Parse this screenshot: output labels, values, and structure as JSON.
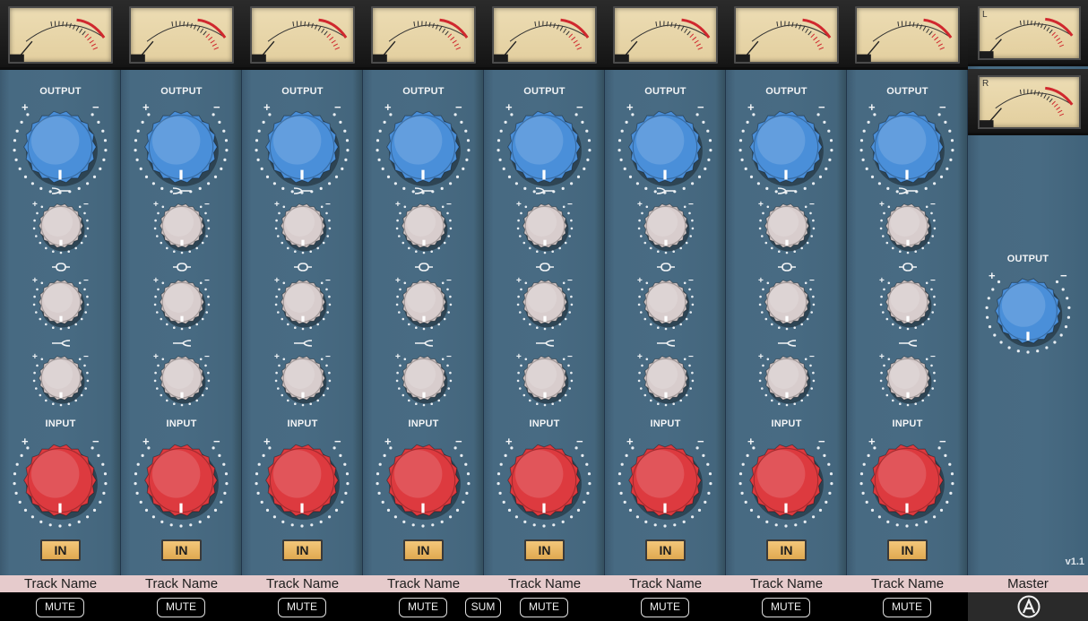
{
  "channels": [
    {
      "output_label": "OUTPUT",
      "input_label": "INPUT",
      "in_label": "IN",
      "track_name": "Track Name",
      "mute_label": "MUTE"
    },
    {
      "output_label": "OUTPUT",
      "input_label": "INPUT",
      "in_label": "IN",
      "track_name": "Track Name",
      "mute_label": "MUTE"
    },
    {
      "output_label": "OUTPUT",
      "input_label": "INPUT",
      "in_label": "IN",
      "track_name": "Track Name",
      "mute_label": "MUTE"
    },
    {
      "output_label": "OUTPUT",
      "input_label": "INPUT",
      "in_label": "IN",
      "track_name": "Track Name",
      "mute_label": "MUTE"
    },
    {
      "output_label": "OUTPUT",
      "input_label": "INPUT",
      "in_label": "IN",
      "track_name": "Track Name",
      "mute_label": "MUTE"
    },
    {
      "output_label": "OUTPUT",
      "input_label": "INPUT",
      "in_label": "IN",
      "track_name": "Track Name",
      "mute_label": "MUTE"
    },
    {
      "output_label": "OUTPUT",
      "input_label": "INPUT",
      "in_label": "IN",
      "track_name": "Track Name",
      "mute_label": "MUTE"
    },
    {
      "output_label": "OUTPUT",
      "input_label": "INPUT",
      "in_label": "IN",
      "track_name": "Track Name",
      "mute_label": "MUTE"
    }
  ],
  "sum_label": "SUM",
  "master": {
    "name": "Master",
    "output_label": "OUTPUT",
    "meter_left_label": "L",
    "meter_right_label": "R",
    "version": "v1.1"
  },
  "symbols": {
    "plus": "+",
    "minus": "−"
  },
  "icons": {
    "low_band": "low-shelf-icon",
    "mid_band": "mid-bell-icon",
    "high_band": "high-shelf-icon",
    "logo": "brand-logo-icon"
  },
  "colors": {
    "panel": "#486b83",
    "output_knob": "#4a8fd9",
    "input_knob": "#dd3a3f",
    "eq_knob": "#d8cdcd",
    "in_button": "#eab864",
    "track_name_bar": "#e6cbcc",
    "meter_face": "#e9d8ae",
    "meter_redline": "#d0282e"
  }
}
